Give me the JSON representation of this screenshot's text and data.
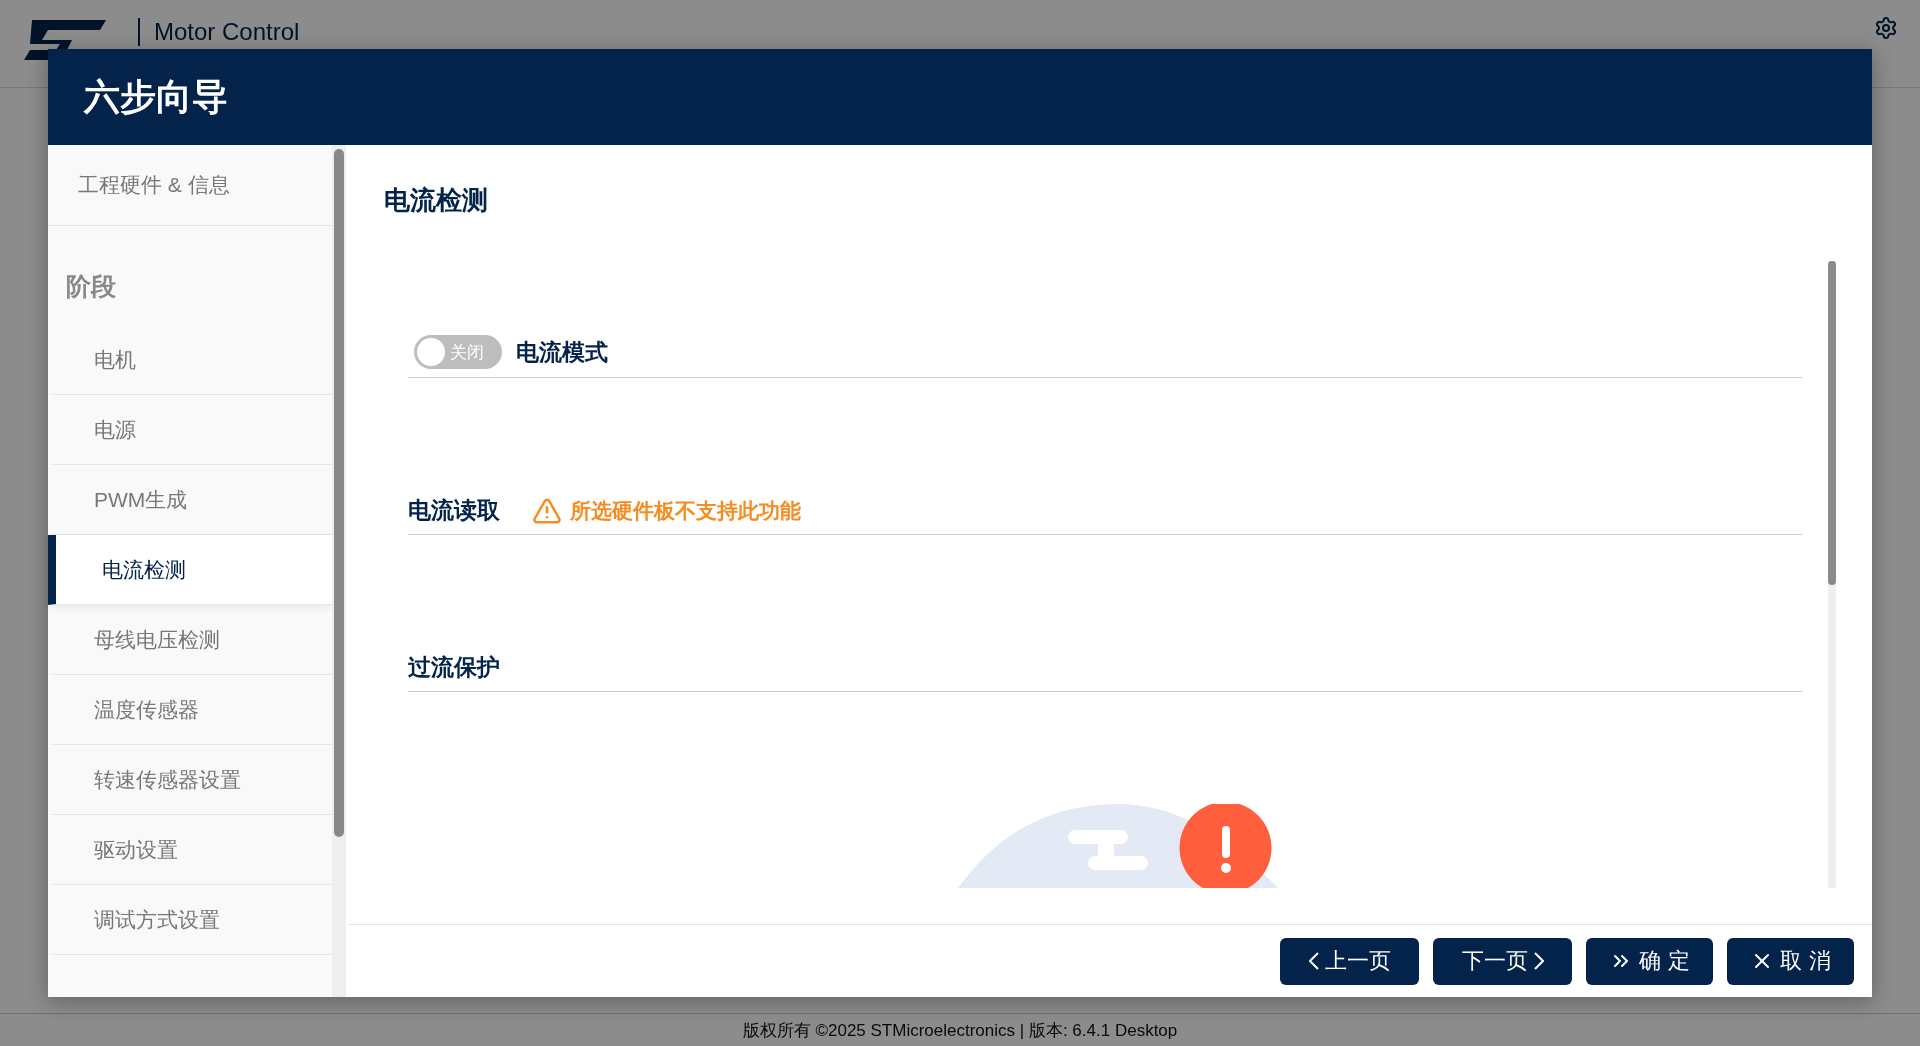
{
  "app_header": {
    "brand": "Motor Control"
  },
  "dialog": {
    "title": "六步向导",
    "sidebar": {
      "top_item": "工程硬件 & 信息",
      "section": "阶段",
      "items": [
        {
          "label": "电机",
          "selected": false
        },
        {
          "label": "电源",
          "selected": false
        },
        {
          "label": "PWM生成",
          "selected": false
        },
        {
          "label": "电流检测",
          "selected": true
        },
        {
          "label": "母线电压检测",
          "selected": false
        },
        {
          "label": "温度传感器",
          "selected": false
        },
        {
          "label": "转速传感器设置",
          "selected": false
        },
        {
          "label": "驱动设置",
          "selected": false
        },
        {
          "label": "调试方式设置",
          "selected": false
        }
      ]
    },
    "page_title": "电流检测",
    "sections": [
      {
        "title": "电流模式",
        "kind": "toggle",
        "toggle": {
          "on": false,
          "label": "关闭"
        }
      },
      {
        "title": "电流读取",
        "kind": "warning",
        "warning": "所选硬件板不支持此功能"
      },
      {
        "title": "过流保护",
        "kind": "plain"
      }
    ],
    "buttons": [
      {
        "label": "上一页",
        "kind": "prev"
      },
      {
        "label": "下一页",
        "kind": "next"
      },
      {
        "label": "确 定",
        "kind": "confirm"
      },
      {
        "label": "取 消",
        "kind": "cancel"
      }
    ]
  },
  "footer": "版权所有 ©2025 STMicroelectronics | 版本: 6.4.1 Desktop"
}
